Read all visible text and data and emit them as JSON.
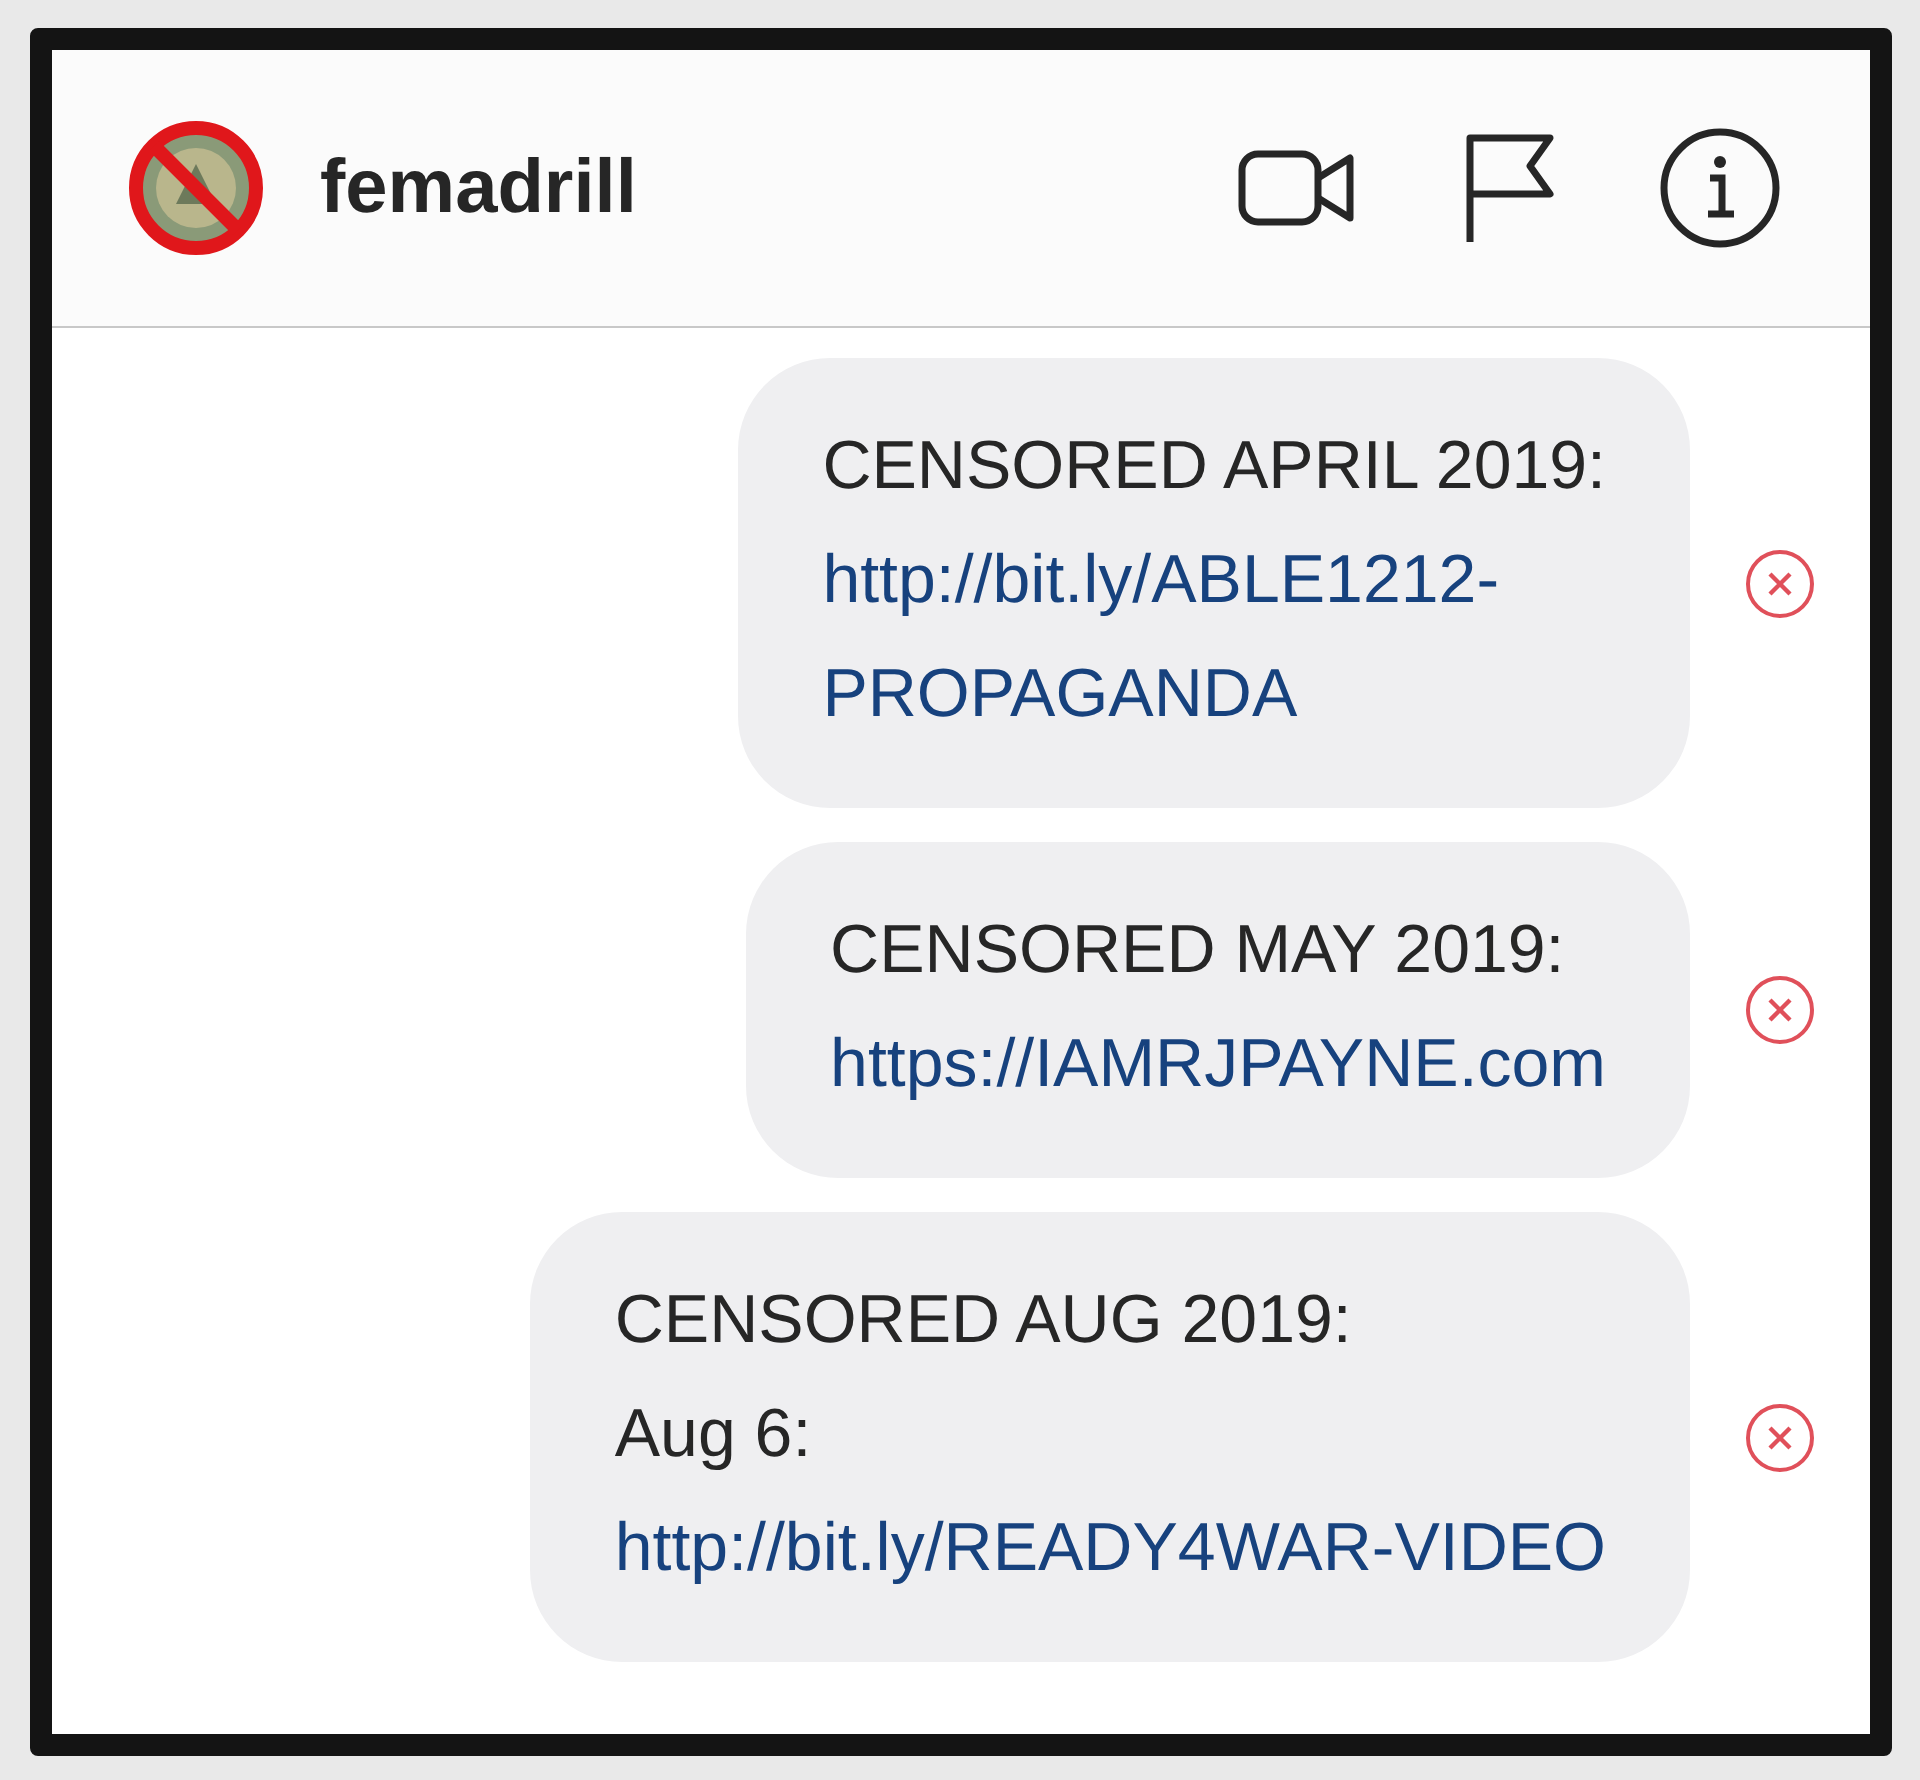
{
  "header": {
    "username": "femadrill"
  },
  "messages": [
    {
      "failed": true,
      "lines": [
        {
          "kind": "plain",
          "text": "CENSORED APRIL 2019:"
        },
        {
          "kind": "link",
          "text": "http://bit.ly/ABLE1212-"
        },
        {
          "kind": "link",
          "text": "PROPAGANDA"
        }
      ]
    },
    {
      "failed": true,
      "lines": [
        {
          "kind": "plain",
          "text": "CENSORED MAY 2019:"
        },
        {
          "kind": "link",
          "text": "https://IAMRJPAYNE.com"
        }
      ]
    },
    {
      "failed": true,
      "lines": [
        {
          "kind": "plain",
          "text": "CENSORED AUG 2019:"
        },
        {
          "kind": "plain",
          "text": "Aug 6:"
        },
        {
          "kind": "link",
          "text": "http://bit.ly/READY4WAR-VIDEO"
        }
      ]
    }
  ]
}
